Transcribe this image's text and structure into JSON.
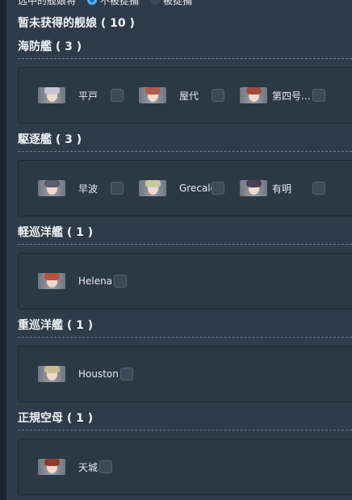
{
  "filter": {
    "label": "选中的舰娘将",
    "option_on": "不被捉捕",
    "option_off": "被捉捕",
    "selected": "option_on"
  },
  "title": "暂未获得的舰娘 ( 10 )",
  "categories": [
    {
      "header": "海防艦 ( 3 )",
      "items": [
        {
          "name": "平戸",
          "color": "#c8c4d6"
        },
        {
          "name": "屋代",
          "color": "#b05a4a"
        },
        {
          "name": "第四号...",
          "color": "#a24a3e"
        }
      ]
    },
    {
      "header": "駆逐艦 ( 3 )",
      "items": [
        {
          "name": "早波",
          "color": "#5c5a6c"
        },
        {
          "name": "Grecale",
          "color": "#c9c6a4"
        },
        {
          "name": "有明",
          "color": "#4b3d55"
        }
      ]
    },
    {
      "header": "軽巡洋艦 ( 1 )",
      "items": [
        {
          "name": "Helena",
          "color": "#b4553c"
        }
      ]
    },
    {
      "header": "重巡洋艦 ( 1 )",
      "items": [
        {
          "name": "Houston",
          "color": "#c9bd94"
        }
      ]
    },
    {
      "header": "正規空母 ( 1 )",
      "items": [
        {
          "name": "天城",
          "color": "#8e3a2c"
        }
      ]
    }
  ]
}
